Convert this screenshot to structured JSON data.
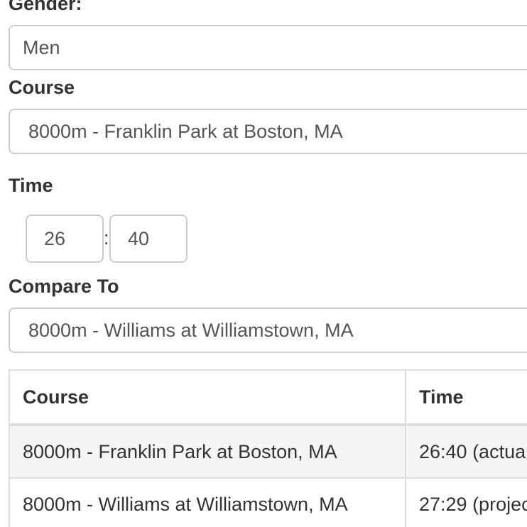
{
  "form": {
    "gender_label": "Gender:",
    "gender_value": "Men",
    "course_label": "Course",
    "course_value": "8000m - Franklin Park at Boston, MA",
    "time_label": "Time",
    "time_minutes": "26",
    "time_separator": ":",
    "time_seconds": "40",
    "compare_label": "Compare To",
    "compare_value": "8000m - Williams at Williamstown, MA"
  },
  "results_table": {
    "headers": [
      "Course",
      "Time"
    ],
    "rows": [
      [
        "8000m - Franklin Park at Boston, MA",
        "26:40 (actua"
      ],
      [
        "8000m - Williams at Williamstown, MA",
        "27:29 (projec"
      ]
    ]
  }
}
